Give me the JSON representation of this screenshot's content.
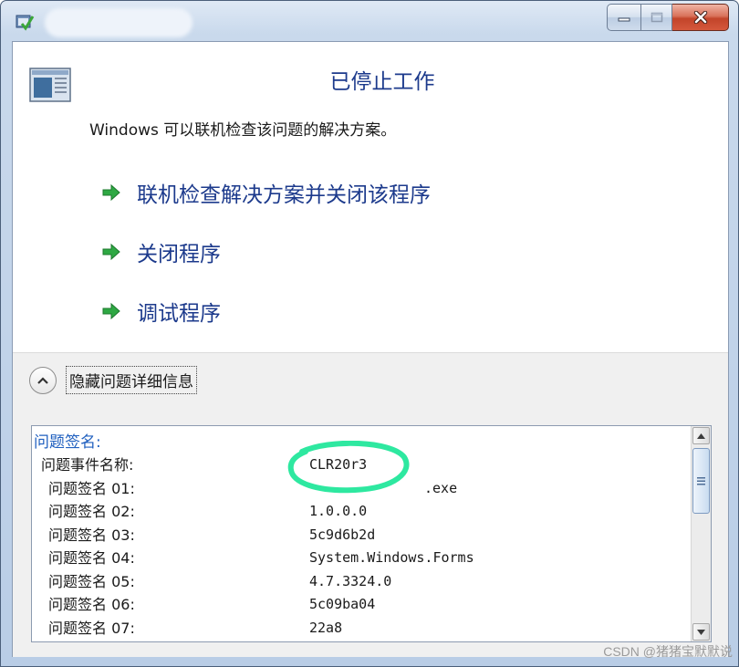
{
  "window": {
    "title_icon": "program-compat-icon",
    "caption_buttons": [
      "minimize-icon",
      "maximize-icon",
      "close-icon"
    ]
  },
  "dialog": {
    "heading": "已停止工作",
    "subtext": "Windows 可以联机检查该问题的解决方案。",
    "commands": [
      {
        "label": "联机检查解决方案并关闭该程序",
        "icon": "green-arrow-icon"
      },
      {
        "label": "关闭程序",
        "icon": "green-arrow-icon"
      },
      {
        "label": "调试程序",
        "icon": "green-arrow-icon"
      }
    ],
    "toggle_label": "隐藏问题详细信息",
    "accent_color": "#1c3a8c"
  },
  "details": {
    "heading": "问题签名:",
    "rows": [
      {
        "key": "问题事件名称:",
        "value": "CLR20r3"
      },
      {
        "key": "问题签名 01:",
        "value": ".exe"
      },
      {
        "key": "问题签名 02:",
        "value": "1.0.0.0"
      },
      {
        "key": "问题签名 03:",
        "value": "5c9d6b2d"
      },
      {
        "key": "问题签名 04:",
        "value": "System.Windows.Forms"
      },
      {
        "key": "问题签名 05:",
        "value": "4.7.3324.0"
      },
      {
        "key": "问题签名 06:",
        "value": "5c09ba04"
      },
      {
        "key": "问题签名 07:",
        "value": "22a8"
      }
    ],
    "highlight_color": "#2ee8a0"
  },
  "watermark": "CSDN @猪猪宝默默说"
}
